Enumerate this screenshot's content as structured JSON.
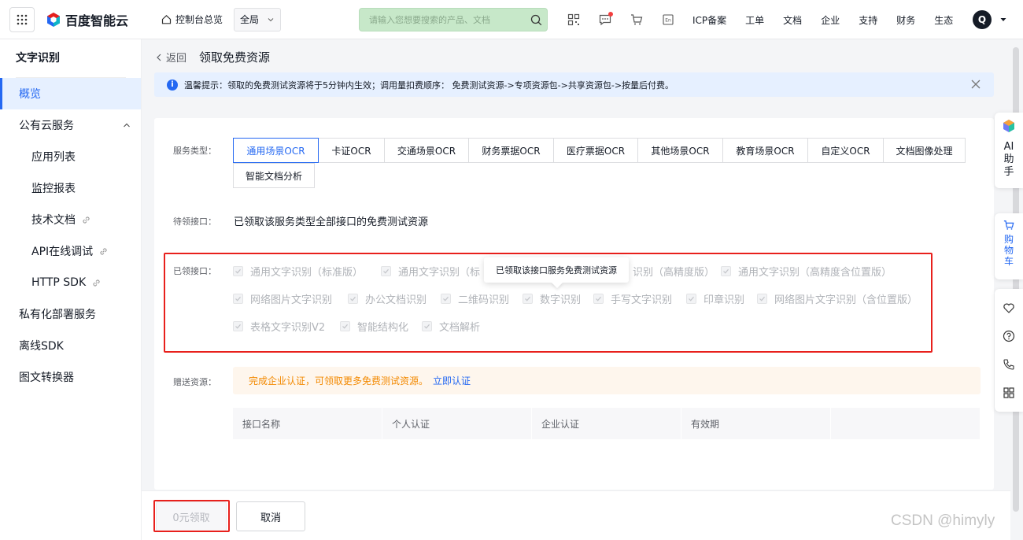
{
  "topbar": {
    "brand": "百度智能云",
    "console": "控制台总览",
    "region": "全局",
    "search_placeholder": "请输入您想要搜索的产品、文档",
    "nav": [
      "ICP备案",
      "工单",
      "文档",
      "企业",
      "支持",
      "财务",
      "生态"
    ],
    "avatar": "Q",
    "icons": [
      "qrcode-icon",
      "message-icon",
      "cart-icon",
      "language-icon"
    ]
  },
  "sidebar": {
    "title": "文字识别",
    "items": [
      {
        "label": "概览",
        "active": true
      },
      {
        "label": "公有云服务",
        "expanded": true
      },
      {
        "label": "应用列表",
        "sub": true
      },
      {
        "label": "监控报表",
        "sub": true
      },
      {
        "label": "技术文档",
        "sub": true,
        "link": true
      },
      {
        "label": "API在线调试",
        "sub": true,
        "link": true
      },
      {
        "label": "HTTP SDK",
        "sub": true,
        "link": true
      },
      {
        "label": "私有化部署服务"
      },
      {
        "label": "离线SDK"
      },
      {
        "label": "图文转换器"
      }
    ]
  },
  "header": {
    "back": "返回",
    "title": "领取免费资源"
  },
  "notice": "温馨提示：领取的免费测试资源将于5分钟内生效；调用量扣费顺序： 免费测试资源->专项资源包->共享资源包->按量后付费。",
  "form": {
    "service_type_label": "服务类型：",
    "tabs": [
      "通用场景OCR",
      "卡证OCR",
      "交通场景OCR",
      "财务票据OCR",
      "医疗票据OCR",
      "其他场景OCR",
      "教育场景OCR",
      "自定义OCR",
      "文档图像处理",
      "智能文档分析"
    ],
    "active_tab": "通用场景OCR",
    "pending_label": "待领接口：",
    "pending_text": "已领取该服务类型全部接口的免费测试资源",
    "claimed_label": "已领接口：",
    "claimed": [
      "通用文字识别（标准版）",
      "通用文字识别（标",
      "识别（高精度版）",
      "通用文字识别（高精度含位置版）",
      "网络图片文字识别",
      "办公文档识别",
      "二维码识别",
      "数字识别",
      "手写文字识别",
      "印章识别",
      "网络图片文字识别（含位置版）",
      "表格文字识别V2",
      "智能结构化",
      "文档解析"
    ],
    "tooltip": "已领取该接口服务免费测试资源",
    "gift_label": "赠送资源：",
    "gift_text": "完成企业认证，可领取更多免费测试资源。",
    "gift_link": "立即认证",
    "table_headers": [
      "接口名称",
      "个人认证",
      "企业认证",
      "有效期",
      ""
    ]
  },
  "footer": {
    "claim": "0元领取",
    "cancel": "取消"
  },
  "float": {
    "ai": "AI助手",
    "cart": "购物车"
  },
  "watermark": "CSDN @himyly",
  "colors": {
    "primary": "#2468f2",
    "highlight": "#e8201c",
    "warning": "#f38900"
  }
}
